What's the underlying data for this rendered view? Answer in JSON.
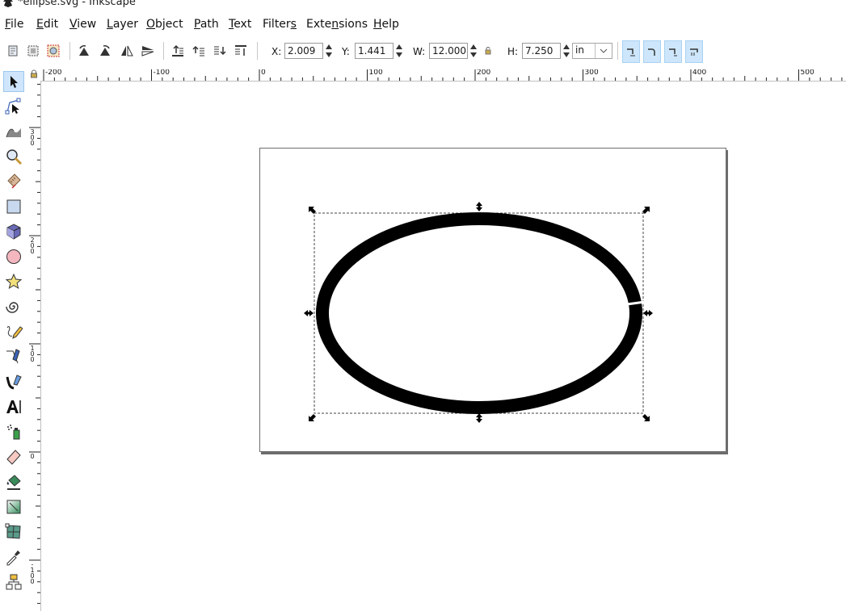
{
  "window": {
    "title": "*ellipse.svg - Inkscape"
  },
  "menubar": {
    "items": [
      {
        "label": "File",
        "underline": "F"
      },
      {
        "label": "Edit",
        "underline": "E"
      },
      {
        "label": "View",
        "underline": "V"
      },
      {
        "label": "Layer",
        "underline": "L"
      },
      {
        "label": "Object",
        "underline": "O"
      },
      {
        "label": "Path",
        "underline": "P"
      },
      {
        "label": "Text",
        "underline": "T"
      },
      {
        "label": "Filters",
        "underline": "s"
      },
      {
        "label": "Extensions",
        "underline": "n"
      },
      {
        "label": "Help",
        "underline": "H"
      }
    ]
  },
  "toolbar": {
    "x_label": "X:",
    "x_value": "2.009",
    "y_label": "Y:",
    "y_value": "1.441",
    "w_label": "W:",
    "w_value": "12.000",
    "h_label": "H:",
    "h_value": "7.250",
    "unit": "in",
    "buttons": [
      "select-all-icon",
      "select-all-in-all-layers-icon",
      "deselect-icon",
      "rotate-ccw-icon",
      "rotate-cw-icon",
      "flip-horizontal-icon",
      "flip-vertical-icon",
      "raise-to-top-icon",
      "raise-icon",
      "lower-icon",
      "lower-to-bottom-icon",
      "lock-ratio-icon",
      "scale-stroke-icon",
      "scale-corners-icon",
      "transform-gradients-icon",
      "transform-patterns-icon"
    ]
  },
  "ruler": {
    "horizontal_labels": [
      "-200",
      "-100",
      "0",
      "100",
      "200",
      "300",
      "400",
      "500"
    ],
    "vertical_labels": [
      "300",
      "200",
      "100",
      "0",
      "-100"
    ]
  },
  "tools": [
    "selector-tool-icon",
    "node-tool-icon",
    "tweak-tool-icon",
    "zoom-tool-icon",
    "measure-tool-icon",
    "rectangle-tool-icon",
    "3d-box-tool-icon",
    "ellipse-tool-icon",
    "star-tool-icon",
    "spiral-tool-icon",
    "pencil-tool-icon",
    "pen-tool-icon",
    "calligraphy-tool-icon",
    "text-tool-icon",
    "spray-tool-icon",
    "eraser-tool-icon",
    "paint-bucket-tool-icon",
    "gradient-tool-icon",
    "mesh-tool-icon",
    "dropper-tool-icon",
    "connector-tool-icon"
  ],
  "colors": {
    "accent": "#cde6fb",
    "stroke": "#000000",
    "page_border": "#6e6e6e"
  }
}
